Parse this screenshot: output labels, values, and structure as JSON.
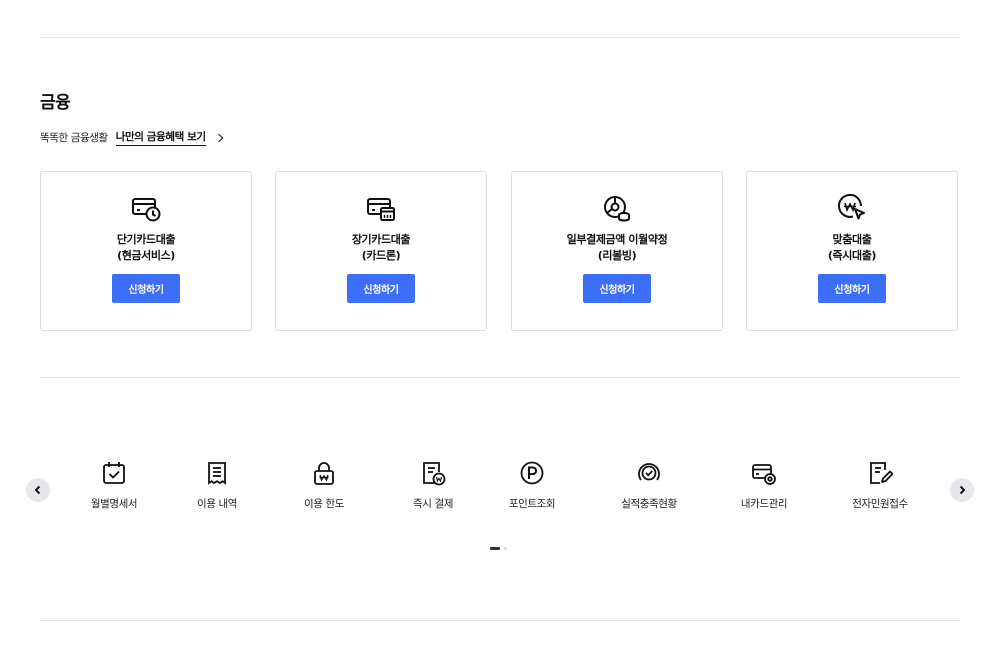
{
  "finance": {
    "title": "금융",
    "subtitle_plain": "똑똑한 금융생활",
    "subtitle_link": "나만의 금융혜택 보기",
    "cards": [
      {
        "name": "단기카드대출\n(현금서비스)",
        "icon": "card-clock-icon",
        "button": "신청하기"
      },
      {
        "name": "장기카드대출\n(카드론)",
        "icon": "card-calendar-icon",
        "button": "신청하기"
      },
      {
        "name": "일부결제금액 이월약정\n(리볼빙)",
        "icon": "pie-coin-icon",
        "button": "신청하기"
      },
      {
        "name": "맞춤대출\n(즉시대출)",
        "icon": "won-cursor-icon",
        "button": "신청하기"
      }
    ]
  },
  "quick_menu": {
    "items": [
      {
        "label": "월별명세서",
        "icon": "calendar-check-icon"
      },
      {
        "label": "이용 내역",
        "icon": "receipt-icon"
      },
      {
        "label": "이용 한도",
        "icon": "lock-won-icon"
      },
      {
        "label": "즉시 결제",
        "icon": "document-won-icon"
      },
      {
        "label": "포인트조회",
        "icon": "point-icon"
      },
      {
        "label": "실적충족현황",
        "icon": "check-circle-icon"
      },
      {
        "label": "내카드관리",
        "icon": "card-gear-icon"
      },
      {
        "label": "전자민원접수",
        "icon": "document-edit-icon"
      }
    ],
    "pagination": {
      "current": 1,
      "total": 2
    }
  },
  "colors": {
    "accent": "#3d6ef7",
    "divider": "#e2e4e8",
    "card_border": "#dcdde1"
  }
}
